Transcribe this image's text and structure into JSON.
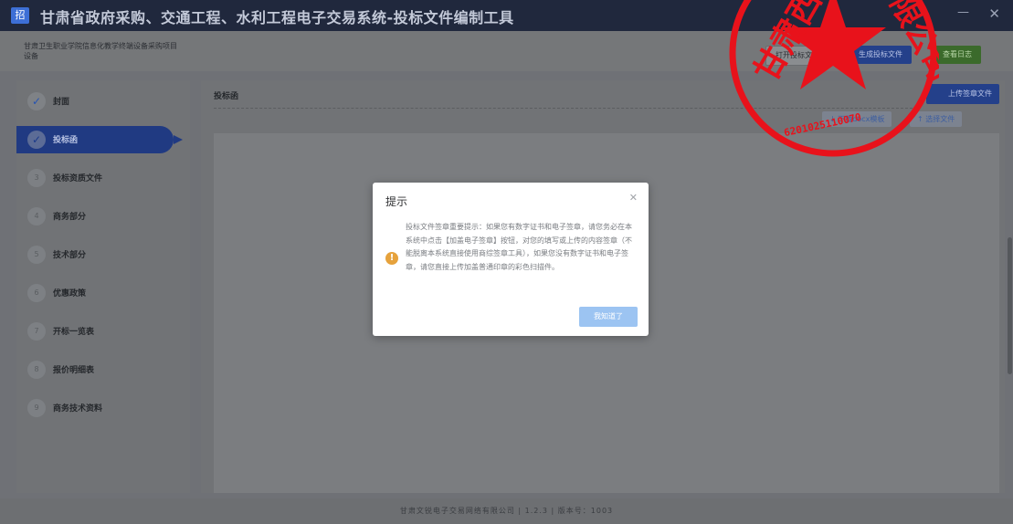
{
  "window": {
    "logo": "招",
    "title": "甘肃省政府采购、交通工程、水利工程电子交易系统-投标文件编制工具"
  },
  "project": {
    "name": "甘肃卫生职业学院信息化教学终端设备采购项目",
    "package": "设备"
  },
  "toolbar": {
    "open_label": "打开投标文件",
    "save_label": "生成投标文件",
    "finish_label": "查看日志"
  },
  "steps": [
    {
      "badge": "✓",
      "label": "封面",
      "done": true
    },
    {
      "badge": "✓",
      "label": "投标函",
      "done": true,
      "active": true
    },
    {
      "badge": "3",
      "label": "投标资质文件"
    },
    {
      "badge": "4",
      "label": "商务部分"
    },
    {
      "badge": "5",
      "label": "技术部分"
    },
    {
      "badge": "6",
      "label": "优惠政策"
    },
    {
      "badge": "7",
      "label": "开标一览表"
    },
    {
      "badge": "8",
      "label": "报价明细表"
    },
    {
      "badge": "9",
      "label": "商务技术资料"
    }
  ],
  "main": {
    "title": "投标函",
    "upload_sign_label": "上传签章文件",
    "download_label": "↓ 下载docx模板",
    "select_label": "↑ 选择文件"
  },
  "dialog": {
    "title": "提示",
    "message": "投标文件签章重要提示：如果您有数字证书和电子签章，请您务必在本系统中点击【加盖电子签章】按钮，对您的填写或上传的内容签章（不能脱离本系统直接使用商综签章工具），如果您没有数字证书和电子签章，请您直接上传加盖普通印章的彩色扫描件。",
    "confirm_label": "我知道了"
  },
  "footer": {
    "text": "甘肃文锐电子交易网络有限公司 | 1.2.3 | 版本号：1003"
  },
  "seal": {
    "text_top": "甘肃西",
    "text_right": "限公司",
    "serial": "6201025110070",
    "color": "#e8121b"
  },
  "colors": {
    "primary": "#24408a",
    "success": "#3b6a2b",
    "warning": "#e6a23c"
  }
}
